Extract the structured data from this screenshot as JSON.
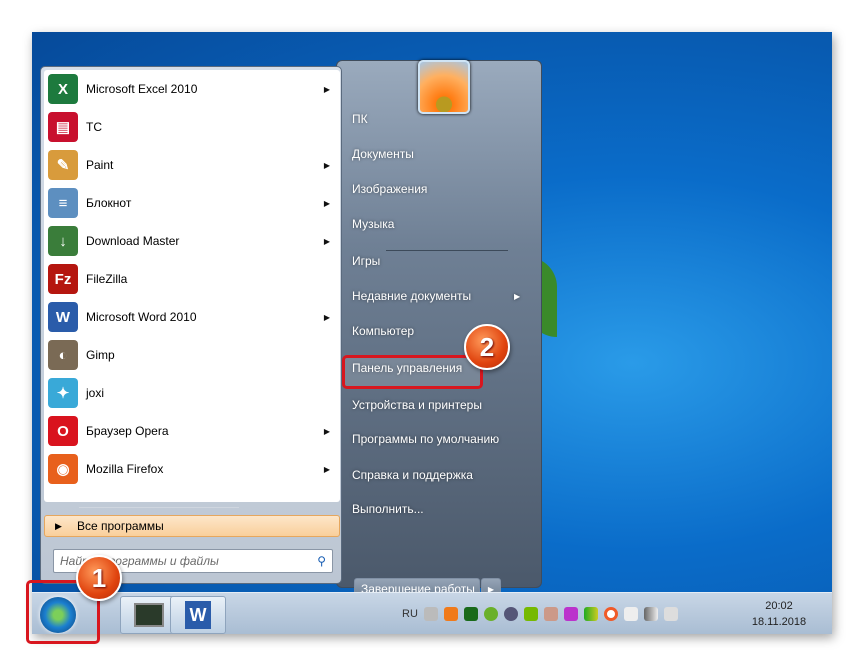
{
  "programs": [
    {
      "label": "Microsoft Excel 2010",
      "icon": "excel-icon",
      "color": "#1d7a3e",
      "glyph": "X",
      "submenu": true
    },
    {
      "label": "TC",
      "icon": "total-commander-icon",
      "color": "#c8102e",
      "glyph": "▤",
      "submenu": false
    },
    {
      "label": "Paint",
      "icon": "paint-icon",
      "color": "#d89b3c",
      "glyph": "✎",
      "submenu": true
    },
    {
      "label": "Блокнот",
      "icon": "notepad-icon",
      "color": "#5d8fc0",
      "glyph": "≡",
      "submenu": true
    },
    {
      "label": "Download Master",
      "icon": "download-master-icon",
      "color": "#3a7d3a",
      "glyph": "↓",
      "submenu": true
    },
    {
      "label": "FileZilla",
      "icon": "filezilla-icon",
      "color": "#b5160f",
      "glyph": "Fz",
      "submenu": false
    },
    {
      "label": "Microsoft Word 2010",
      "icon": "word-icon",
      "color": "#2a5caa",
      "glyph": "W",
      "submenu": true
    },
    {
      "label": "Gimp",
      "icon": "gimp-icon",
      "color": "#7a6a55",
      "glyph": "◐",
      "submenu": false
    },
    {
      "label": "joxi",
      "icon": "joxi-icon",
      "color": "#39a9d8",
      "glyph": "✦",
      "submenu": false
    },
    {
      "label": "Браузер Opera",
      "icon": "opera-icon",
      "color": "#d9131e",
      "glyph": "O",
      "submenu": true
    },
    {
      "label": "Mozilla Firefox",
      "icon": "firefox-icon",
      "color": "#e8601c",
      "glyph": "◉",
      "submenu": true
    }
  ],
  "all_programs": "Все программы",
  "search_placeholder": "Найти программы и файлы",
  "right_items": [
    {
      "label": "ПК"
    },
    {
      "label": "Документы"
    },
    {
      "label": "Изображения"
    },
    {
      "label": "Музыка"
    },
    {
      "label": "Игры"
    },
    {
      "label": "Недавние документы",
      "submenu": true
    },
    {
      "label": "Компьютер"
    },
    {
      "label": "Панель управления",
      "highlighted": true
    },
    {
      "label": "Устройства и принтеры"
    },
    {
      "label": "Программы по умолчанию"
    },
    {
      "label": "Справка и поддержка"
    },
    {
      "label": "Выполнить..."
    }
  ],
  "shutdown": "Завершение работы",
  "tray": {
    "lang": "RU",
    "time": "20:02",
    "date": "18.11.2018"
  },
  "badges": {
    "one": "1",
    "two": "2"
  },
  "colors": {
    "highlight": "#d8161e",
    "badge": "#e0440f"
  }
}
